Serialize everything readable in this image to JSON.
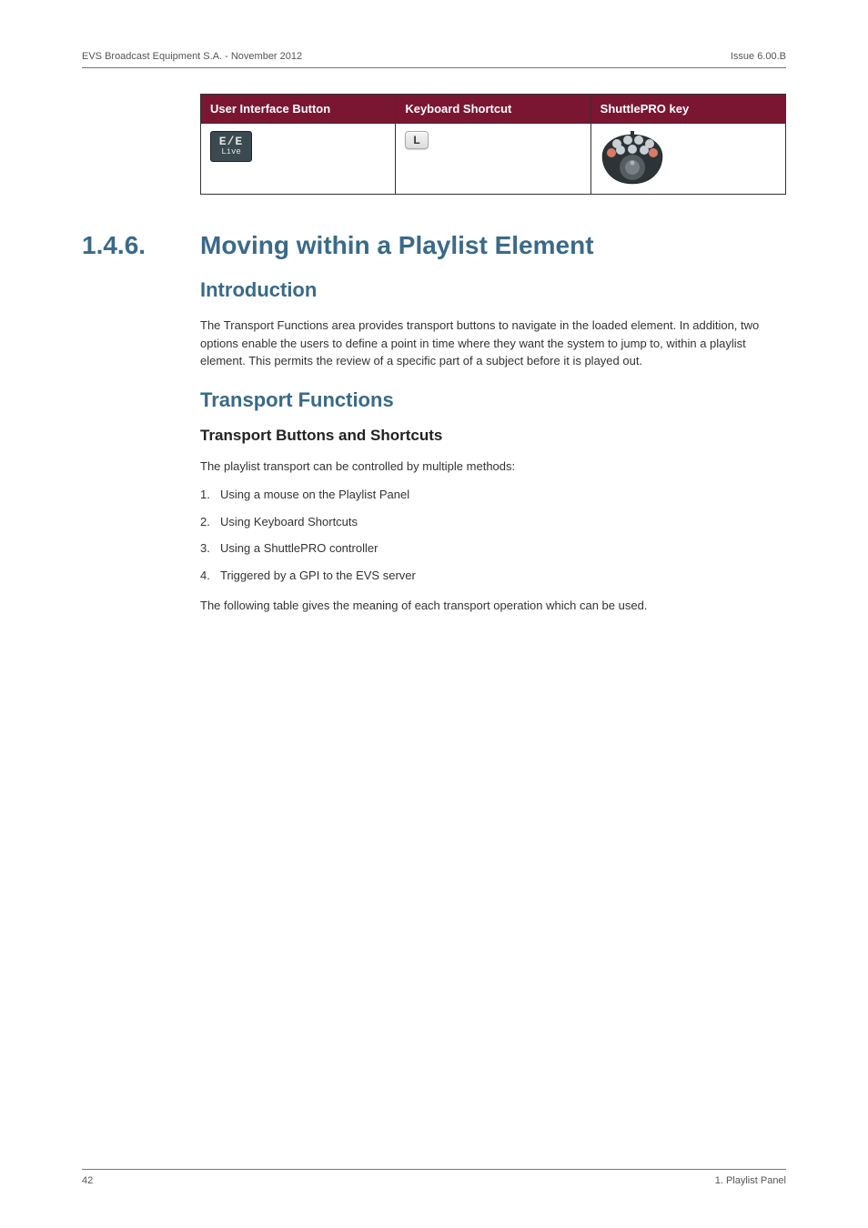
{
  "header": {
    "left": "EVS Broadcast Equipment S.A. - November 2012",
    "right": "Issue 6.00.B"
  },
  "table": {
    "headers": {
      "c1": "User Interface Button",
      "c2": "Keyboard Shortcut",
      "c3": "ShuttlePRO key"
    },
    "row": {
      "ee_big": "E/E",
      "ee_small": "Live",
      "key": "L"
    }
  },
  "section": {
    "num": "1.4.6.",
    "title": "Moving within a Playlist Element"
  },
  "intro": {
    "heading": "Introduction",
    "para": "The Transport Functions area provides transport buttons to navigate in the loaded element. In addition, two options enable the users to define a point in time where they want the system to jump to, within a playlist element. This permits the review of a specific part of a subject before it is played out."
  },
  "tf": {
    "heading": "Transport Functions",
    "sub": "Transport Buttons and Shortcuts",
    "lead": "The playlist transport can be controlled by multiple methods:",
    "items": [
      "Using a mouse on the Playlist Panel",
      "Using Keyboard Shortcuts",
      "Using a ShuttlePRO controller",
      "Triggered by a GPI to the EVS server"
    ],
    "tail": "The following table gives the meaning of each transport operation which can be used."
  },
  "footer": {
    "left": "42",
    "right": "1. Playlist Panel"
  }
}
